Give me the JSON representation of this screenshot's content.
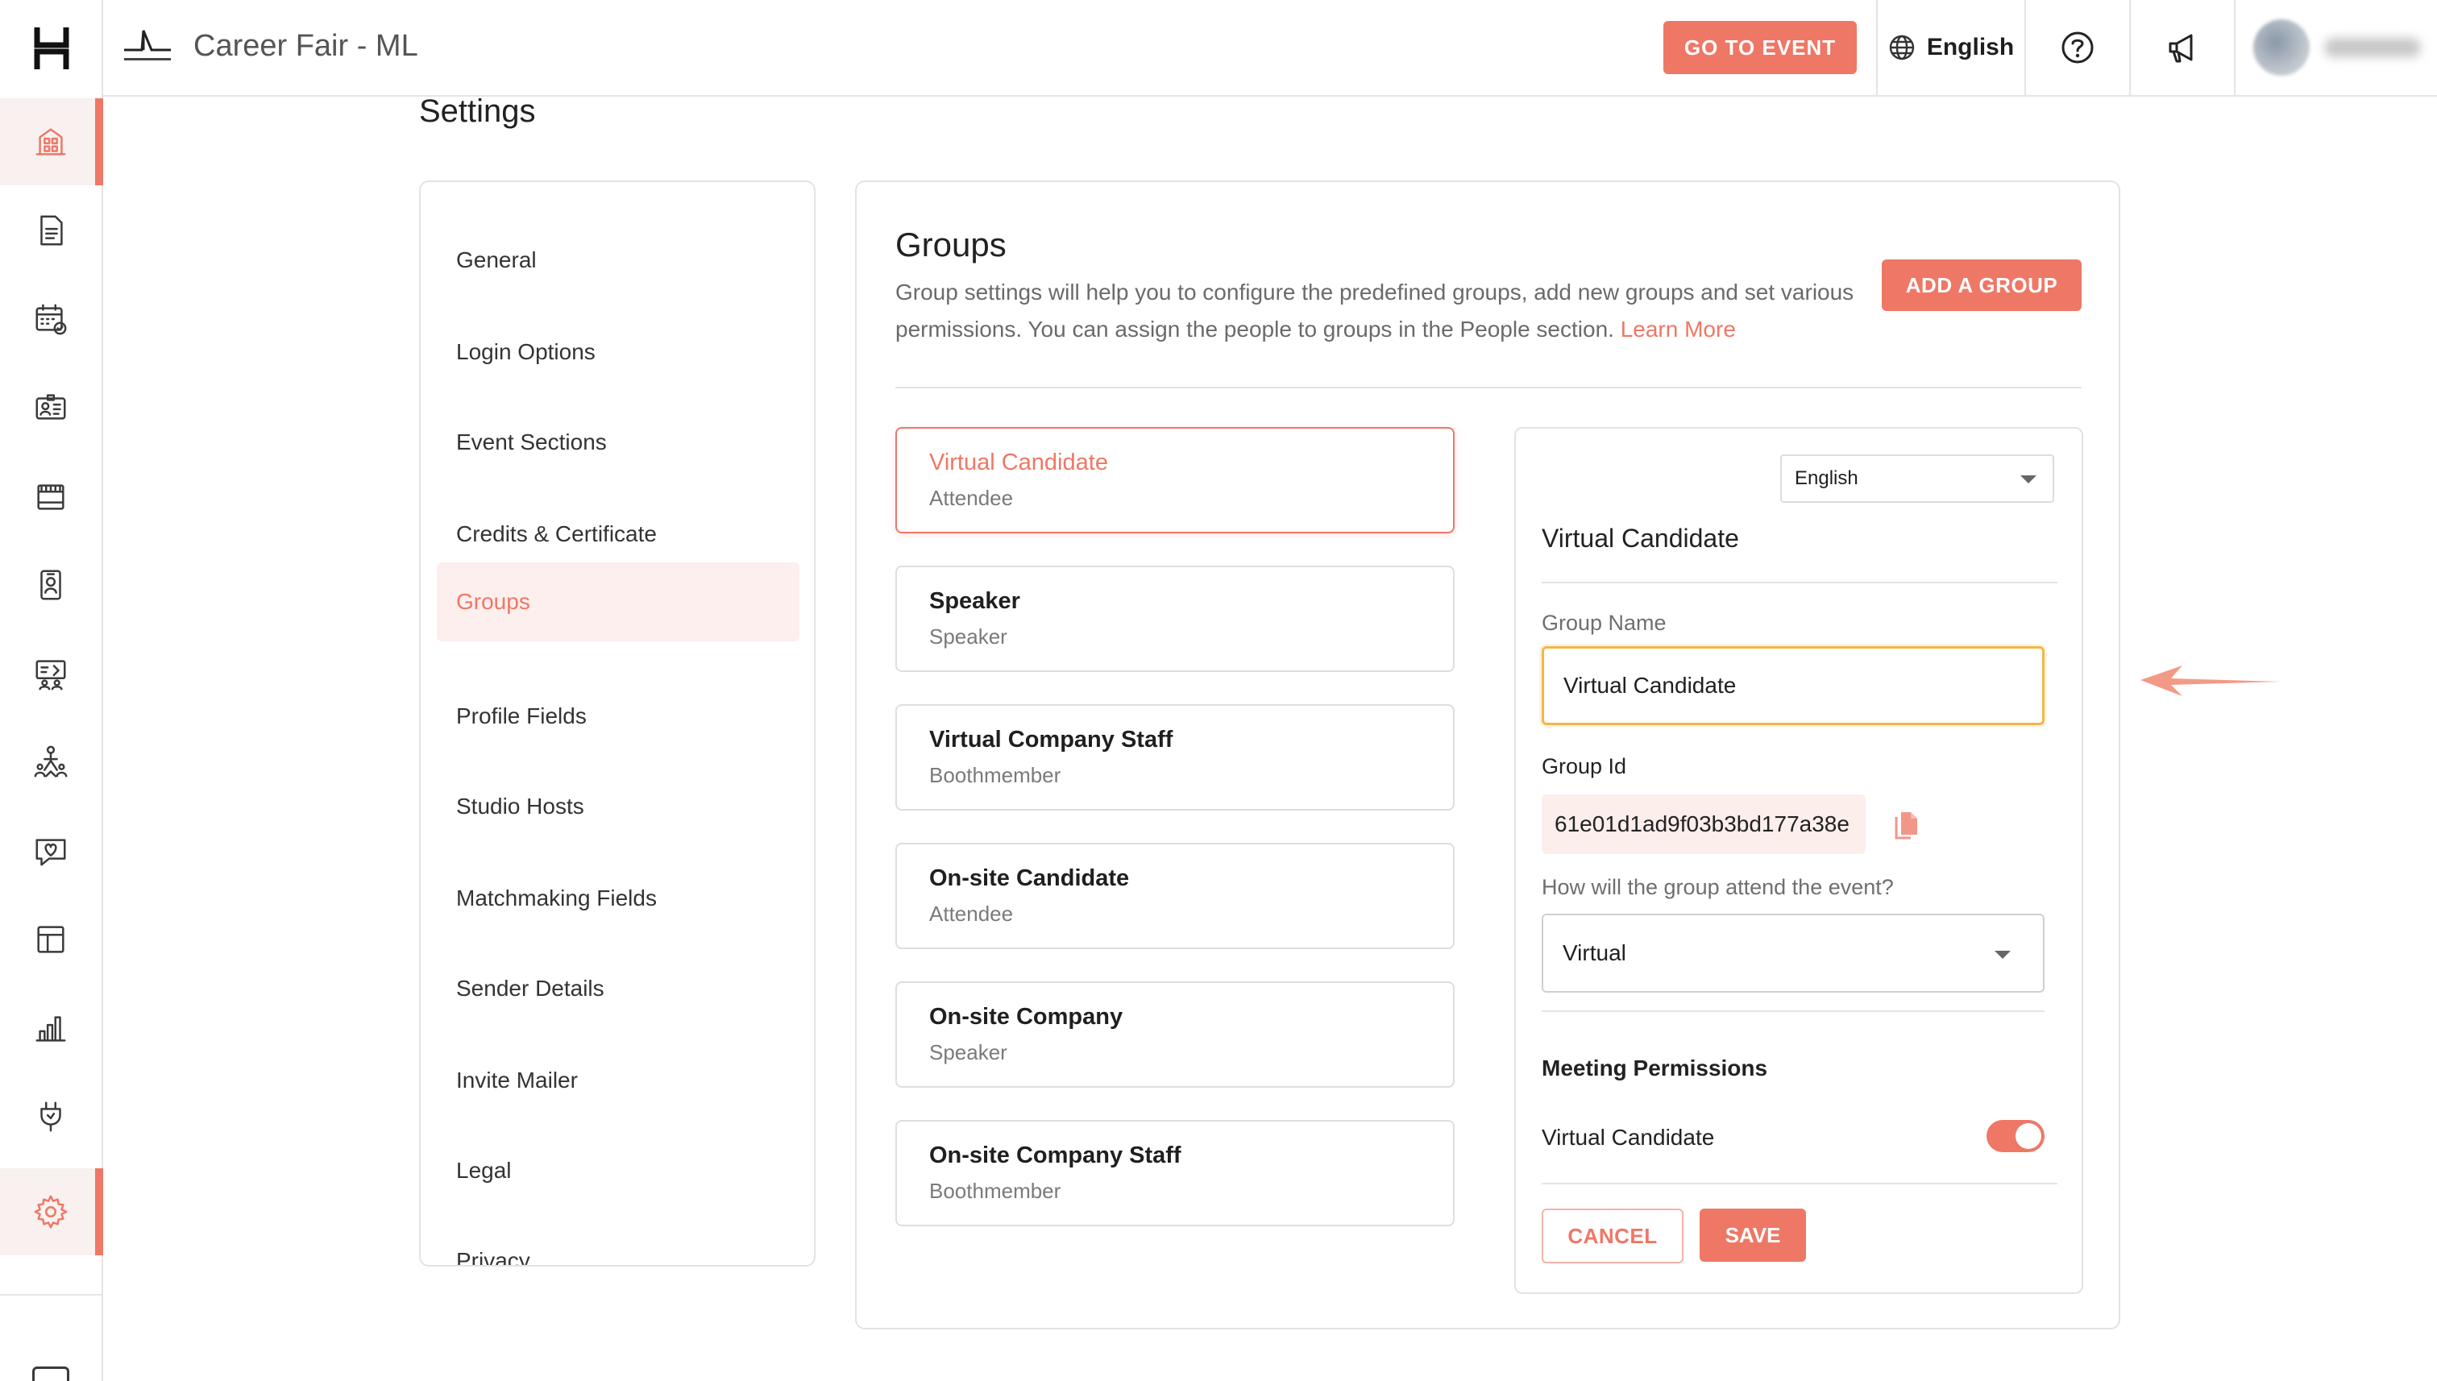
{
  "app": {
    "logo_icon": "hubilo-logo-icon"
  },
  "topbar": {
    "event_title": "Career Fair - ML",
    "go_to_event_label": "GO TO EVENT",
    "language": "English",
    "accent": "#ef7766"
  },
  "rail": {
    "items": [
      {
        "icon": "building-icon",
        "active": true
      },
      {
        "icon": "document-icon"
      },
      {
        "icon": "calendar-icon"
      },
      {
        "icon": "id-card-icon"
      },
      {
        "icon": "booth-icon"
      },
      {
        "icon": "badge-icon"
      },
      {
        "icon": "lounge-icon"
      },
      {
        "icon": "networking-icon"
      },
      {
        "icon": "engagement-icon"
      },
      {
        "icon": "layout-icon"
      },
      {
        "icon": "analytics-icon"
      },
      {
        "icon": "integrations-icon"
      },
      {
        "icon": "settings-icon",
        "active": true
      }
    ]
  },
  "settings": {
    "title": "Settings",
    "nav": [
      {
        "label": "General"
      },
      {
        "label": "Login Options"
      },
      {
        "label": "Event Sections"
      },
      {
        "label": "Credits & Certificate"
      },
      {
        "label": "Groups",
        "active": true
      },
      {
        "label": "Profile Fields"
      },
      {
        "label": "Studio Hosts"
      },
      {
        "label": "Matchmaking Fields"
      },
      {
        "label": "Sender Details"
      },
      {
        "label": "Invite Mailer"
      },
      {
        "label": "Legal"
      },
      {
        "label": "Privacy"
      }
    ]
  },
  "groups": {
    "title": "Groups",
    "description": "Group settings will help you to configure the predefined groups, add new groups and set various permissions. You can assign the people to groups in the People section.",
    "learn_more": "Learn More",
    "add_button": "ADD A GROUP",
    "list": [
      {
        "name": "Virtual Candidate",
        "role": "Attendee",
        "selected": true
      },
      {
        "name": "Speaker",
        "role": "Speaker"
      },
      {
        "name": "Virtual Company Staff",
        "role": "Boothmember"
      },
      {
        "name": "On-site Candidate",
        "role": "Attendee"
      },
      {
        "name": "On-site Company",
        "role": "Speaker"
      },
      {
        "name": "On-site Company Staff",
        "role": "Boothmember"
      }
    ]
  },
  "detail": {
    "language": "English",
    "title": "Virtual Candidate",
    "group_name_label": "Group Name",
    "group_name_value": "Virtual Candidate",
    "group_id_label": "Group Id",
    "group_id_value": "61e01d1ad9f03b3bd177a38e",
    "attend_label": "How will the group attend the event?",
    "attend_value": "Virtual",
    "meeting_permissions_title": "Meeting Permissions",
    "permission_label": "Virtual Candidate",
    "permission_enabled": true,
    "cancel_label": "CANCEL",
    "save_label": "SAVE",
    "highlight_color": "#f5b547"
  }
}
